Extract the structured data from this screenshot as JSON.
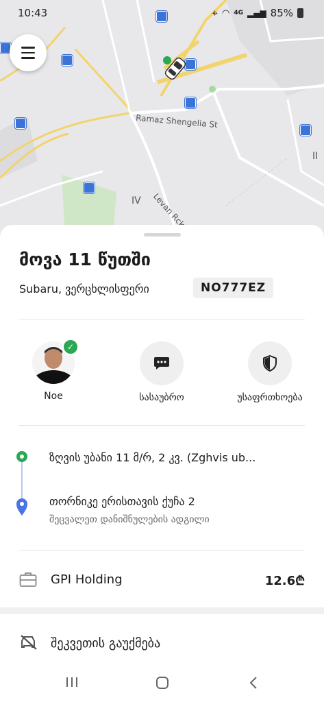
{
  "status_bar": {
    "time": "10:43",
    "network": "4G",
    "battery": "85%"
  },
  "map": {
    "street_label_1": "Ramaz Shengelia St",
    "street_label_2": "Levan Rck",
    "district_label": "IV",
    "district_label_2": "II",
    "road_color": "#f3d36b",
    "park_color": "#cfe7c6"
  },
  "trip": {
    "eta": "მოვა 11 წუთში",
    "car_description": "Subaru, ვერცხლისფერი",
    "plate": "NO777EZ"
  },
  "actions": {
    "driver_name": "Noe",
    "chat_label": "სასაუბრო",
    "safety_label": "უსაფრთხოება"
  },
  "route": {
    "pickup": "ზღვის უბანი 11 მ/რ, 2 კვ. (Zghvis ub...",
    "destination": "თორნიკე ერისთავის ქუჩა 2",
    "destination_hint": "შეცვალეთ დანიშნულების ადგილი",
    "pickup_color": "#2aa853",
    "destination_color": "#4a73e8"
  },
  "payment": {
    "name": "GPI Holding",
    "amount": "12.6₾"
  },
  "cancel": {
    "label": "შეკვეთის გაუქმება"
  },
  "icons": {
    "menu": "hamburger-icon",
    "chat": "chat-bubble-icon",
    "safety": "shield-icon",
    "payment": "briefcase-icon",
    "cancel": "car-cancel-icon",
    "verified": "verified-check-icon"
  }
}
